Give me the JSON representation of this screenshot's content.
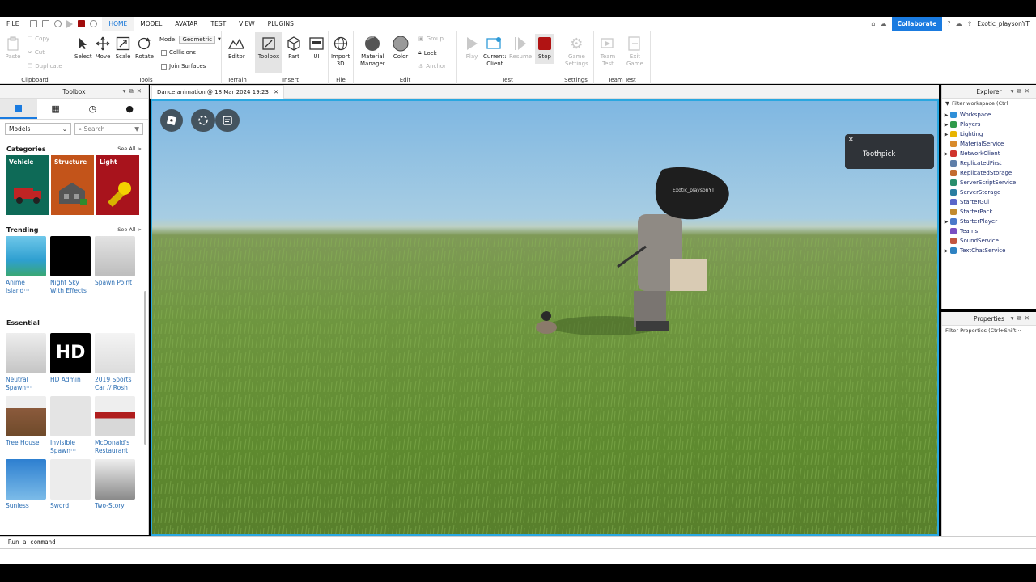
{
  "menu": {
    "file": "FILE",
    "tabs": [
      "HOME",
      "MODEL",
      "AVATAR",
      "TEST",
      "VIEW",
      "PLUGINS"
    ],
    "active_tab": "HOME",
    "collaborate": "Collaborate",
    "username": "Exotic_playsonYT"
  },
  "ribbon": {
    "clipboard": {
      "label": "Clipboard",
      "paste": "Paste",
      "copy": "Copy",
      "cut": "Cut",
      "duplicate": "Duplicate"
    },
    "tools": {
      "label": "Tools",
      "select": "Select",
      "move": "Move",
      "scale": "Scale",
      "rotate": "Rotate",
      "mode_label": "Mode:",
      "mode_value": "Geometric",
      "collisions": "Collisions",
      "join_surfaces": "Join Surfaces"
    },
    "terrain": {
      "label": "Terrain",
      "editor": "Editor"
    },
    "insert": {
      "label": "Insert",
      "toolbox": "Toolbox",
      "part": "Part",
      "ui": "UI"
    },
    "file": {
      "label": "File",
      "import3d_1": "Import",
      "import3d_2": "3D"
    },
    "edit": {
      "label": "Edit",
      "material_1": "Material",
      "material_2": "Manager",
      "color": "Color",
      "group": "Group",
      "lock": "Lock",
      "anchor": "Anchor"
    },
    "test": {
      "label": "Test",
      "play": "Play",
      "current_1": "Current:",
      "current_2": "Client",
      "resume": "Resume",
      "stop": "Stop"
    },
    "settings": {
      "label": "Settings",
      "game_1": "Game",
      "game_2": "Settings"
    },
    "team_test": {
      "label": "Team Test",
      "team_1": "Team",
      "team_2": "Test",
      "exit_1": "Exit",
      "exit_2": "Game"
    }
  },
  "toolbox": {
    "title": "Toolbox",
    "dropdown": "Models",
    "search_placeholder": "Search",
    "categories_title": "Categories",
    "see_all": "See All >",
    "categories": [
      {
        "label": "Vehicle",
        "color": "#0e6a57"
      },
      {
        "label": "Structure",
        "color": "#c3541a"
      },
      {
        "label": "Light",
        "color": "#a8131c"
      }
    ],
    "trending_title": "Trending",
    "trending": [
      {
        "name": "Anime Island···",
        "color": "#4fb4d9"
      },
      {
        "name": "Night Sky With Effects",
        "color": "#000000"
      },
      {
        "name": "Spawn Point",
        "color": "#c9c9c9"
      }
    ],
    "essential_title": "Essential",
    "essential_row1": [
      {
        "name": "Neutral Spawn···",
        "color": "#cfcfcf"
      },
      {
        "name": "HD Admin",
        "color": "#000000",
        "badge": "HD"
      },
      {
        "name": "2019 Sports Car // Rosh",
        "color": "#ebebeb"
      }
    ],
    "essential_row2": [
      {
        "name": "Tree House",
        "color": "#8b5a3c"
      },
      {
        "name": "Invisible Spawn···",
        "color": "#e4e4e4"
      },
      {
        "name": "McDonald's Restaurant",
        "color": "#d8d8d8"
      }
    ],
    "essential_row3": [
      {
        "name": "Sunless",
        "color": "#4a9be0"
      },
      {
        "name": "Sword",
        "color": "#e8e8e8"
      },
      {
        "name": "Two-Story",
        "color": "#bcbcbc"
      }
    ]
  },
  "document_tab": "Dance animation @ 18 Mar 2024 19:23",
  "viewport": {
    "toast": "Toothpick",
    "nametag": "Exotic_playsonYT"
  },
  "explorer": {
    "title": "Explorer",
    "filter": "Filter workspace (Ctrl···",
    "items": [
      {
        "name": "Workspace",
        "color": "#2f8fd8",
        "arrow": true
      },
      {
        "name": "Players",
        "color": "#2f9a4a",
        "arrow": true
      },
      {
        "name": "Lighting",
        "color": "#e8b400",
        "arrow": true
      },
      {
        "name": "MaterialService",
        "color": "#d88a2a",
        "arrow": false
      },
      {
        "name": "NetworkClient",
        "color": "#d0342c",
        "arrow": true
      },
      {
        "name": "ReplicatedFirst",
        "color": "#5e7ea8",
        "arrow": false
      },
      {
        "name": "ReplicatedStorage",
        "color": "#c46b2f",
        "arrow": false
      },
      {
        "name": "ServerScriptService",
        "color": "#2a8e6b",
        "arrow": false
      },
      {
        "name": "ServerStorage",
        "color": "#2a7ea0",
        "arrow": false
      },
      {
        "name": "StarterGui",
        "color": "#5a66c9",
        "arrow": false
      },
      {
        "name": "StarterPack",
        "color": "#c28a2e",
        "arrow": false
      },
      {
        "name": "StarterPlayer",
        "color": "#4a79c9",
        "arrow": true
      },
      {
        "name": "Teams",
        "color": "#7a4fc2",
        "arrow": false
      },
      {
        "name": "SoundService",
        "color": "#c2553f",
        "arrow": false
      },
      {
        "name": "TextChatService",
        "color": "#2e82c2",
        "arrow": true
      }
    ]
  },
  "properties": {
    "title": "Properties",
    "filter": "Filter Properties (Ctrl+Shift···"
  },
  "command_bar": "Run a command"
}
